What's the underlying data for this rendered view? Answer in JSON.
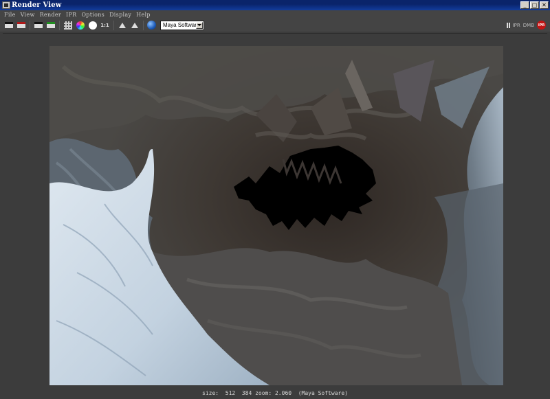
{
  "window": {
    "title": "Render View",
    "controls": [
      "_",
      "□",
      "✕"
    ]
  },
  "menu": {
    "items": [
      "File",
      "View",
      "Render",
      "IPR",
      "Options",
      "Display",
      "Help"
    ]
  },
  "toolbar": {
    "one_to_one_label": "1:1",
    "renderer": "Maya Software",
    "right": {
      "ipr_label": "IPR",
      "dmb_label": "DMB",
      "ipr_badge": "IPR"
    }
  },
  "status": {
    "text": "size:  512  384 zoom: 2.060  (Maya Software)"
  },
  "colors": {
    "titlebar": "#0a246a",
    "chrome": "#444444",
    "viewport_bg": "#3c3c3c"
  }
}
